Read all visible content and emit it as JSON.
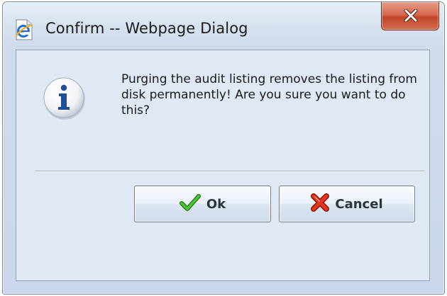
{
  "window": {
    "title": "Confirm -- Webpage Dialog",
    "title_icon": "ie-page-icon",
    "close_icon": "close-x-icon"
  },
  "dialog": {
    "icon": "info-icon",
    "message": "Purging the audit listing removes the listing from disk permanently! Are you sure you want to do this?"
  },
  "buttons": {
    "ok_label": "Ok",
    "ok_icon": "green-check-icon",
    "cancel_label": "Cancel",
    "cancel_icon": "red-x-icon"
  },
  "colors": {
    "close_button": "#c1452a",
    "ok_check": "#3aa028",
    "cancel_x": "#d22a16",
    "info_glyph": "#1f4e9c"
  }
}
